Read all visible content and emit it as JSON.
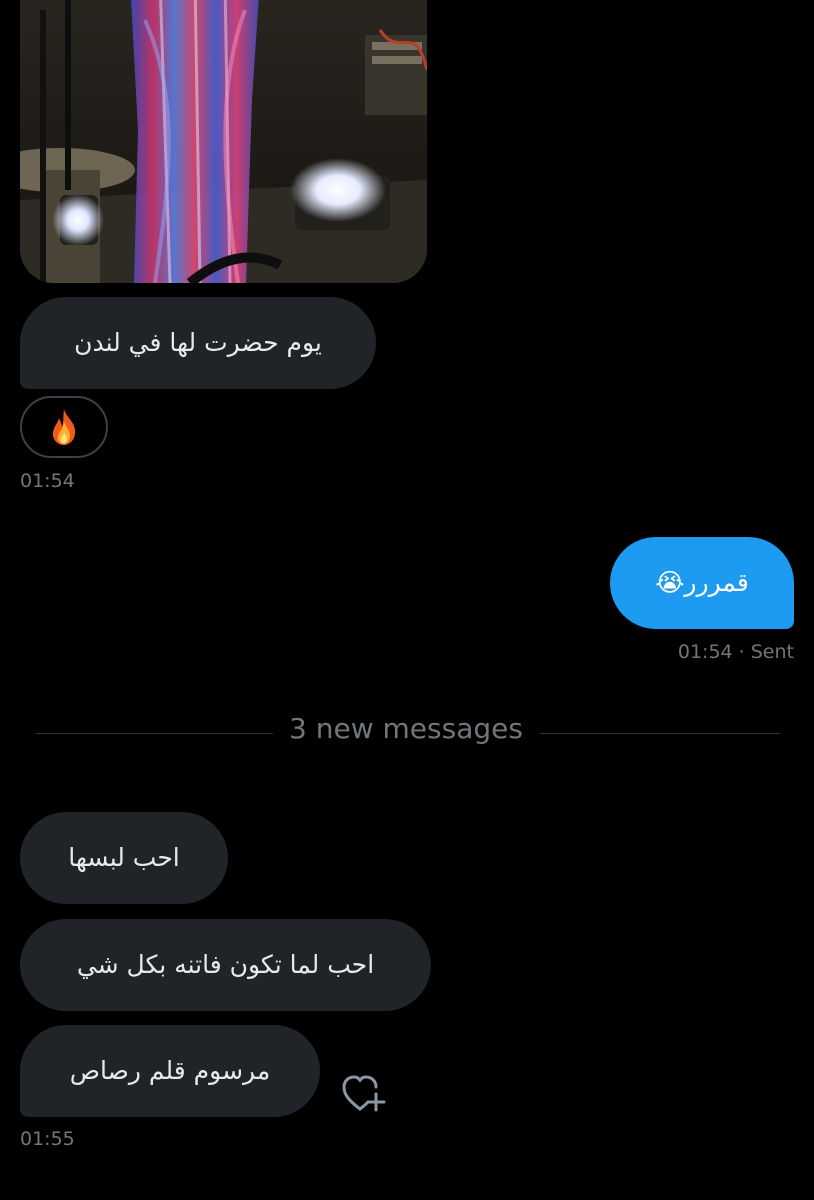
{
  "conversation": {
    "messages": [
      {
        "direction": "received",
        "text": "يوم حضرت لها في لندن"
      },
      {
        "direction": "sent",
        "text": "قمررر😭"
      },
      {
        "direction": "received",
        "text": "احب لبسها"
      },
      {
        "direction": "received",
        "text": "احب لما تكون فاتنه بكل شي"
      },
      {
        "direction": "received",
        "text": "مرسوم قلم رصاص"
      }
    ],
    "reaction": {
      "emoji": "🔥",
      "icon": "fire-icon"
    },
    "timestamps": {
      "first_received": "01:54",
      "sent": "01:54",
      "sent_status": "· Sent",
      "last_received": "01:55"
    },
    "new_messages_divider": "3 new messages",
    "add_reaction_icon": "heart-plus-icon"
  },
  "colors": {
    "background": "#000000",
    "received_bubble": "#202327",
    "sent_bubble": "#1d9bf0",
    "secondary_text": "#71767b"
  }
}
